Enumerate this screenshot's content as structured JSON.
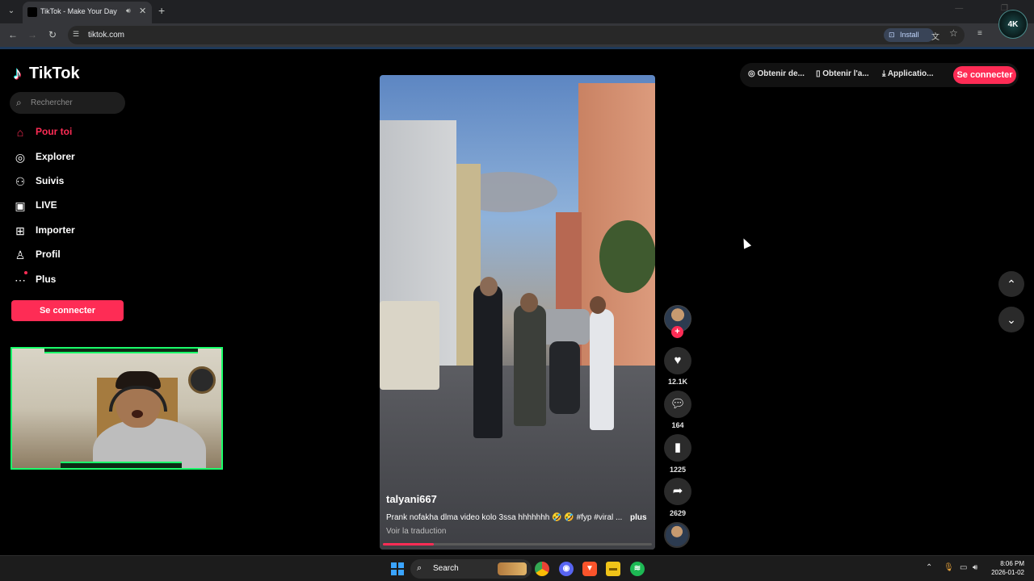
{
  "browser": {
    "tab_title": "TikTok - Make Your Day",
    "url": "tiktok.com",
    "install_label": "Install",
    "corner_logo_text": "4K"
  },
  "sidebar": {
    "logo_text": "TikTok",
    "search_placeholder": "Rechercher",
    "items": [
      {
        "label": "Pour toi",
        "icon": "home-icon",
        "active": true
      },
      {
        "label": "Explorer",
        "icon": "compass-icon",
        "active": false
      },
      {
        "label": "Suivis",
        "icon": "following-icon",
        "active": false
      },
      {
        "label": "LIVE",
        "icon": "live-tv-icon",
        "active": false
      },
      {
        "label": "Importer",
        "icon": "upload-plus-icon",
        "active": false
      },
      {
        "label": "Profil",
        "icon": "profile-icon",
        "active": false
      },
      {
        "label": "Plus",
        "icon": "more-dots-icon",
        "active": false
      }
    ],
    "login_label": "Se connecter"
  },
  "video": {
    "author": "talyani667",
    "caption": "Prank nofakha dlma video kolo 3ssa hhhhhhh 🤣 🤣 #fyp #viral ...",
    "more_label": "plus",
    "translate_label": "Voir la traduction",
    "progress_fraction": 0.19
  },
  "actions": {
    "follow_label": "+",
    "likes": "12.1K",
    "comments": "164",
    "saves": "1225",
    "shares": "2629"
  },
  "topbar": {
    "item1": "Obtenir de...",
    "item2": "Obtenir l'a...",
    "item3": "Applicatio...",
    "login_label": "Se connecter"
  },
  "taskbar": {
    "search_label": "Search",
    "time": "8:06 PM",
    "date": "2026-01-02"
  },
  "colors": {
    "accent": "#fe2c55",
    "webcam_frame": "#1aff6a"
  }
}
